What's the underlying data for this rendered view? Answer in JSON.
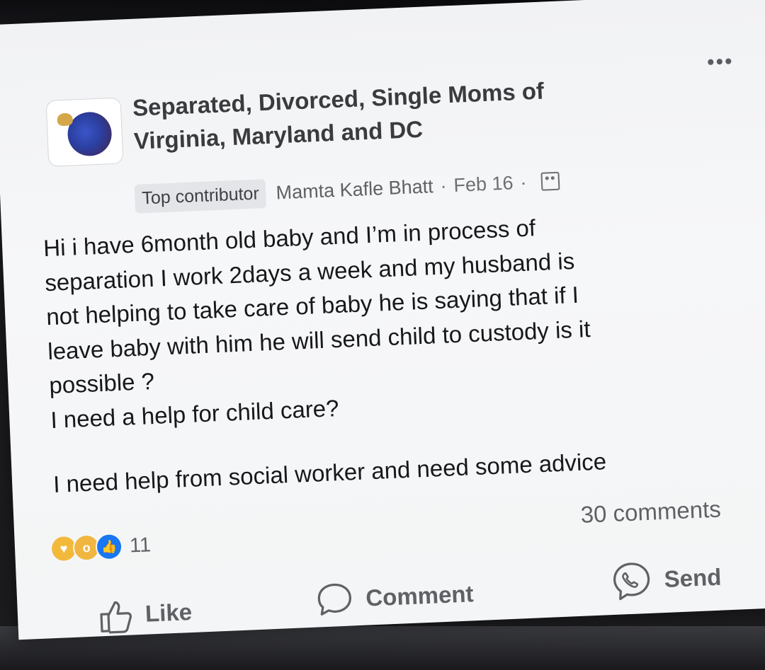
{
  "post": {
    "group_name_line1": "Separated, Divorced, Single Moms of",
    "group_name_line2": "Virginia, Maryland and DC",
    "badge": "Top contributor",
    "author": "Mamta Kafle Bhatt",
    "separator": "·",
    "date": "Feb 16",
    "more_icon": "more-horizontal-icon",
    "audience_icon": "group-members-icon",
    "body": {
      "line1": "Hi i have 6month old baby and I’m in process of",
      "line2": "separation I work 2days a week and my husband is",
      "line3": "not helping to take care of baby he is saying that if I",
      "line4": "leave baby with him he will send child to custody is it",
      "line5": "possible ?",
      "line6": "I need a help for child care?",
      "line7": "I need help from social worker and need some advice"
    },
    "reactions": {
      "icons": [
        "care-reaction-icon",
        "wow-reaction-icon",
        "like-reaction-icon"
      ],
      "count": "11"
    },
    "comments_count": "30 comments"
  },
  "actions": {
    "like_label": "Like",
    "comment_label": "Comment",
    "send_label": "Send"
  }
}
